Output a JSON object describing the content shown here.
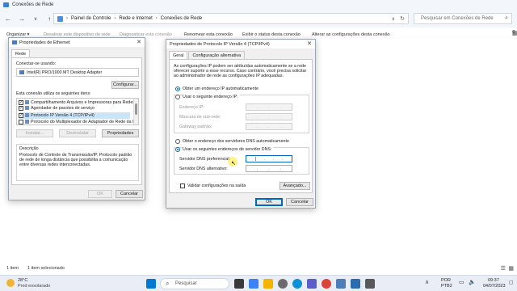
{
  "explorer": {
    "title": "Conexões de Rede",
    "breadcrumb": [
      "Painel de Controle",
      "Rede e Internet",
      "Conexões de Rede"
    ],
    "search_placeholder": "Pesquisar em Conexões de Rede",
    "commands": [
      "Organizar ▾",
      "Desativar este dispositivo de rede",
      "Diagnosticar esta conexão",
      "Renomear esta conexão",
      "Exibir o status desta conexão",
      "Alterar as configurações desta conexão"
    ],
    "status_items": "1 item",
    "status_selected": "1 item selecionado"
  },
  "eth_dialog": {
    "title": "Propriedades de Ethernet",
    "tab": "Rede",
    "connect_using_label": "Conectar-se usando:",
    "adapter": "Intel(R) PRO/1000 MT Desktop Adapter",
    "configure_btn": "Configurar...",
    "items_label": "Esta conexão utiliza os seguintes itens:",
    "items": [
      "Compartilhamento Arquivos e Impressoras para Redes",
      "Agendador de pacotes de serviço",
      "Protocolo IP Versão 4 (TCP/IPv4)",
      "Protocolo do Multiplexador de Adaptador de Rede da M"
    ],
    "install_btn": "Instalar...",
    "uninstall_btn": "Desinstalar",
    "properties_btn": "Propriedades",
    "description_title": "Descrição",
    "description": [
      "Protocolo de Controle de Transmissão/IP. Protocolo padrão",
      "de rede de longa distância que possibilita a comunicação",
      "entre diversas redes interconectadas."
    ],
    "ok_btn": "OK",
    "cancel_btn": "Cancelar"
  },
  "ipv4_dialog": {
    "title": "Propriedades de Protocolo IP Versão 4 (TCP/IPv4)",
    "tabs": [
      "Geral",
      "Configuração alternativa"
    ],
    "intro": [
      "As configurações IP podem ser atribuídas automaticamente se a rede",
      "oferecer suporte a esse recurso. Caso contrário, você precisa solicitar",
      "ao administrador de rede as configurações IP adequadas."
    ],
    "auto_ip": "Obter um endereço IP automaticamente",
    "manual_ip": "Usar o seguinte endereço IP:",
    "ip_label": "Endereço IP:",
    "mask_label": "Máscara de sub-rede:",
    "gateway_label": "Gateway padrão:",
    "auto_dns": "Obter o endereço dos servidores DNS automaticamente",
    "manual_dns": "Usar os seguintes endereços de servidor DNS:",
    "pref_dns_label": "Servidor DNS preferencial:",
    "alt_dns_label": "Servidor DNS alternativo:",
    "validate_label": "Validar configurações na saída",
    "advanced_btn": "Avançado...",
    "ok_btn": "OK",
    "cancel_btn": "Cancelar"
  },
  "taskbar": {
    "temperature": "28°C",
    "weather": "Pred ensolarado",
    "search_placeholder": "Pesquisar",
    "lang1": "POR",
    "lang2": "PTB2",
    "time": "09:37",
    "date": "04/07/2023"
  }
}
